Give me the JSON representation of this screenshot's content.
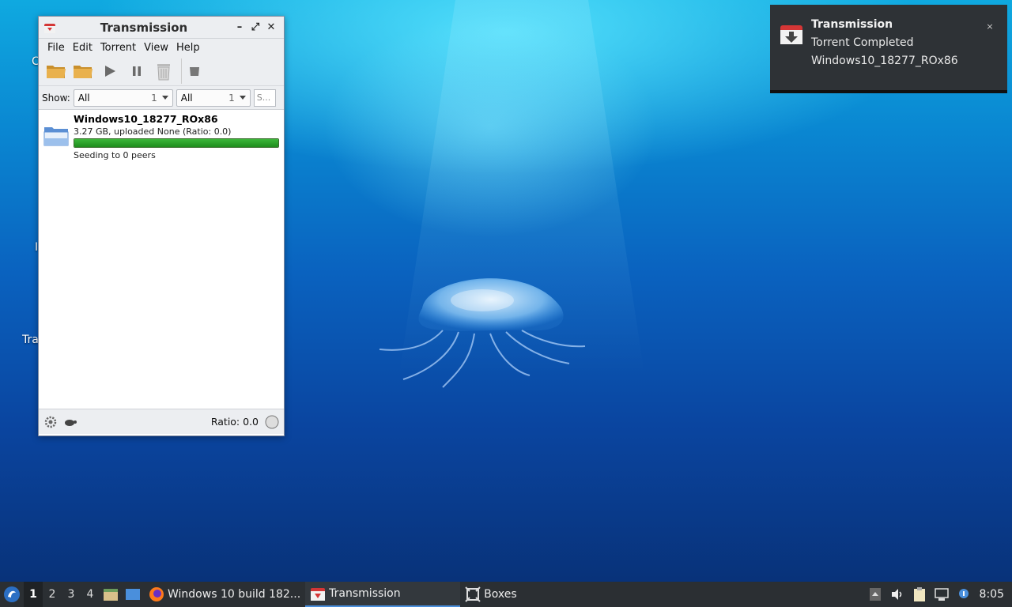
{
  "desktop": {
    "labels": [
      "C",
      "I",
      "Tra"
    ]
  },
  "window": {
    "title": "Transmission",
    "controls": {
      "minimize": "–",
      "maximize": "⤢",
      "close": "✕"
    },
    "menu": [
      "File",
      "Edit",
      "Torrent",
      "View",
      "Help"
    ],
    "toolbar": [
      "open-icon",
      "open-url-icon",
      "start-icon",
      "pause-icon",
      "remove-icon",
      "properties-icon"
    ],
    "filter": {
      "show_label": "Show:",
      "activity": {
        "value": "All",
        "count": "1"
      },
      "tracker": {
        "value": "All",
        "count": "1"
      },
      "search_placeholder": "S..."
    },
    "torrents": [
      {
        "name": "Windows10_18277_ROx86",
        "details": "3.27 GB, uploaded None (Ratio: 0.0)",
        "progress": 1.0,
        "status": "Seeding to 0 peers"
      }
    ],
    "statusbar": {
      "ratio": "Ratio: 0.0"
    }
  },
  "notification": {
    "title": "Transmission",
    "line1": "Torrent Completed",
    "line2": "Windows10_18277_ROx86",
    "close": "×"
  },
  "taskbar": {
    "workspaces": [
      "1",
      "2",
      "3",
      "4"
    ],
    "active_workspace": "1",
    "tasks": [
      {
        "label": "Windows 10 build 182...",
        "icon": "firefox-icon"
      },
      {
        "label": "Transmission",
        "icon": "transmission-icon",
        "active": true
      },
      {
        "label": "Boxes",
        "icon": "boxes-icon"
      }
    ],
    "clock": "8:05"
  },
  "colors": {
    "progress": "#2a9d28",
    "notification_bg": "#2e3236",
    "taskbar_bg": "#2b2f33",
    "accent": "#4a8fdc"
  }
}
